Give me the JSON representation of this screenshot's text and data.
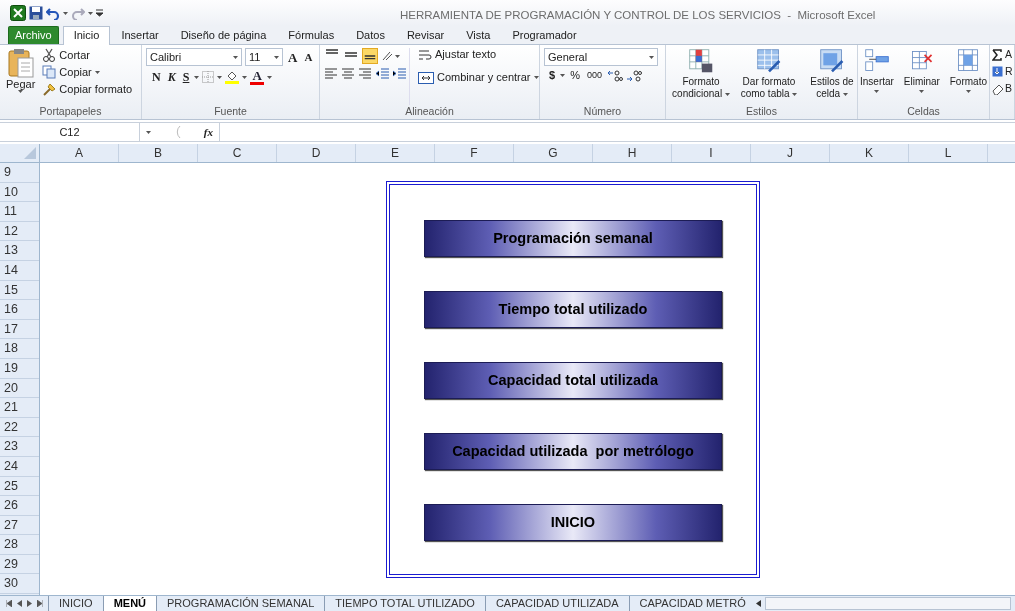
{
  "window": {
    "title": "HERRAMIENTA DE PROGRAMACIÓN Y CONTROL DE LOS SERVICIOS  -  Microsoft Excel"
  },
  "ribbon_tabs": [
    {
      "label": "Archivo",
      "kind": "file",
      "selected": false
    },
    {
      "label": "Inicio",
      "kind": "tab",
      "selected": true
    },
    {
      "label": "Insertar",
      "kind": "tab",
      "selected": false
    },
    {
      "label": "Diseño de página",
      "kind": "tab",
      "selected": false
    },
    {
      "label": "Fórmulas",
      "kind": "tab",
      "selected": false
    },
    {
      "label": "Datos",
      "kind": "tab",
      "selected": false
    },
    {
      "label": "Revisar",
      "kind": "tab",
      "selected": false
    },
    {
      "label": "Vista",
      "kind": "tab",
      "selected": false
    },
    {
      "label": "Programador",
      "kind": "tab",
      "selected": false
    }
  ],
  "ribbon_groups": [
    {
      "kind": "clipboard",
      "title": "Portapapeles",
      "paste": "Pegar",
      "items": [
        "Cortar",
        "Copiar",
        "Copiar formato"
      ]
    },
    {
      "kind": "font",
      "title": "Fuente",
      "font_name": "Calibri",
      "font_size": "11",
      "grow": "A",
      "shrink": "A",
      "styles": [
        "N",
        "K",
        "S"
      ],
      "font_color": "A"
    },
    {
      "kind": "alignment",
      "title": "Alineación",
      "vertical": [
        {
          "selected": false
        },
        {
          "selected": false
        },
        {
          "selected": true
        }
      ],
      "wrap": "Ajustar texto",
      "merge": "Combinar y centrar"
    },
    {
      "kind": "number",
      "title": "Número",
      "format": "General",
      "currency": "$",
      "percent": "%",
      "thousands": "000"
    },
    {
      "kind": "styles",
      "title": "Estilos",
      "buttons": [
        "Formato condicional",
        "Dar formato como tabla",
        "Estilos de celda"
      ]
    },
    {
      "kind": "cells",
      "title": "Celdas",
      "buttons": [
        "Insertar",
        "Eliminar",
        "Formato"
      ]
    },
    {
      "kind": "editing",
      "items": [
        "A",
        "R",
        "B"
      ]
    }
  ],
  "formula_bar": {
    "name_box": "C12",
    "function_label": "fx"
  },
  "sheet": {
    "columns": [
      "A",
      "B",
      "C",
      "D",
      "E",
      "F",
      "G",
      "H",
      "I",
      "J",
      "K",
      "L"
    ],
    "rows": [
      "9",
      "10",
      "11",
      "12",
      "13",
      "14",
      "15",
      "16",
      "17",
      "18",
      "19",
      "20",
      "21",
      "22",
      "23",
      "24",
      "25",
      "26",
      "27",
      "28",
      "29",
      "30"
    ]
  },
  "menu_panel": {
    "buttons": [
      "Programación semanal",
      "Tiempo total utilizado",
      "Capacidad total utilizada",
      "Capacidad utilizada  por metrólogo",
      "INICIO"
    ]
  },
  "sheet_tabs": [
    {
      "label": "INICIO",
      "selected": false
    },
    {
      "label": "MENÚ",
      "selected": true
    },
    {
      "label": "PROGRAMACIÓN SEMANAL",
      "selected": false
    },
    {
      "label": "TIEMPO TOTAL UTILIZADO",
      "selected": false
    },
    {
      "label": "CAPACIDAD UTILIZADA",
      "selected": false
    },
    {
      "label": "CAPACIDAD METRÓ",
      "selected": false
    }
  ]
}
